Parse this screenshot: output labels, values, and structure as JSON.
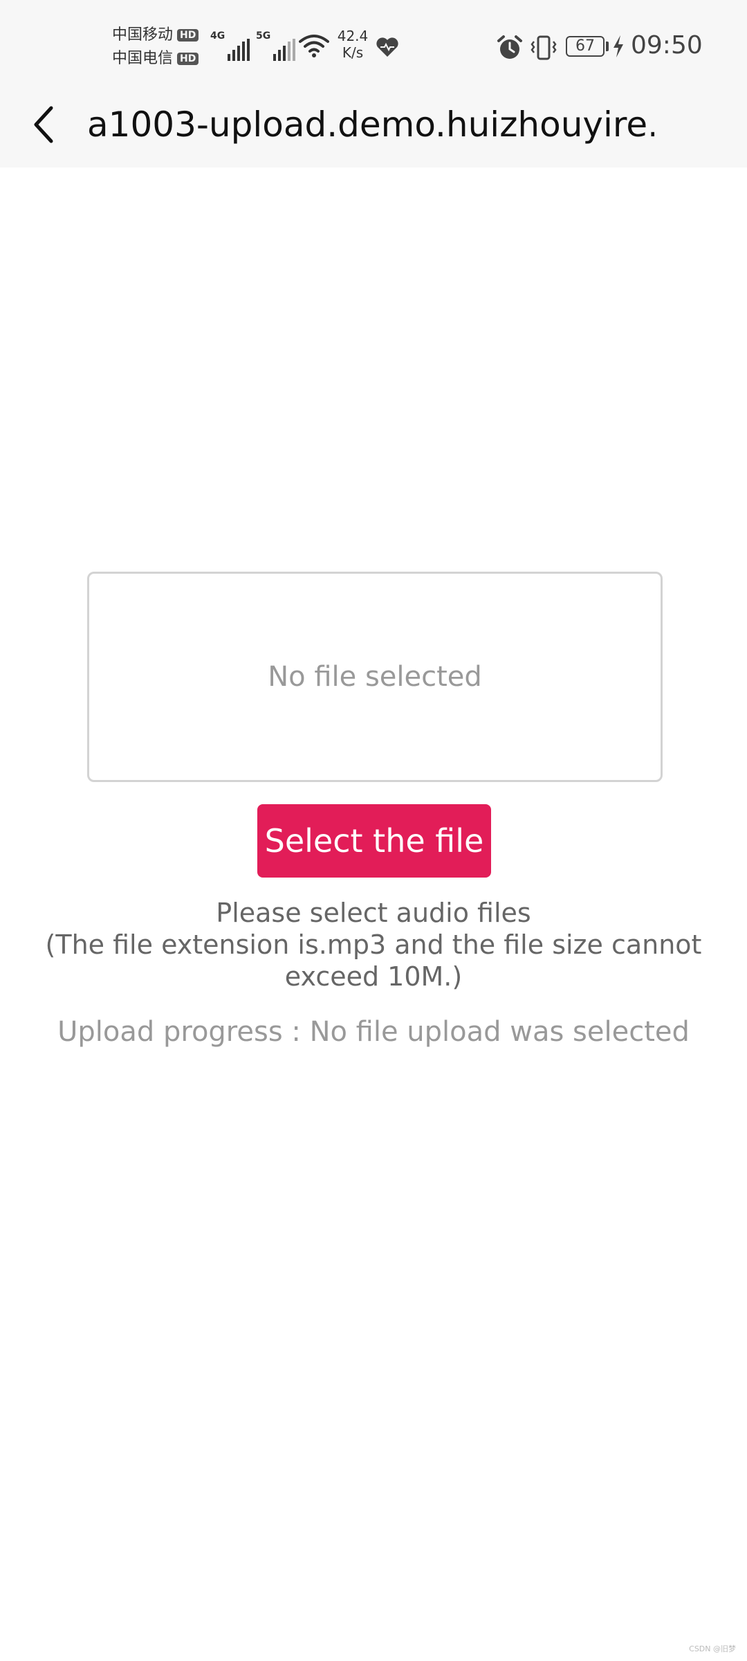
{
  "status_bar": {
    "carrier_1": "中国移动",
    "carrier_2": "中国电信",
    "hd_label": "HD",
    "network_1": "4G",
    "network_2": "5G",
    "speed_value": "42.4",
    "speed_unit": "K/s",
    "battery_level": "67",
    "time": "09:50",
    "icons": [
      "signal-icon",
      "wifi-icon",
      "heart-icon",
      "alarm-icon",
      "vibrate-icon",
      "battery-icon",
      "charging-icon"
    ]
  },
  "header": {
    "back_icon": "chevron-left-icon",
    "title": "a1003-upload.demo.huizhouyire..."
  },
  "main": {
    "file_status": "No file selected",
    "select_button_label": "Select the file",
    "hint_line_1": "Please select audio files",
    "hint_line_2": "(The file extension is.mp3 and the file size cannot exceed 10M.)",
    "progress_text": "Upload progress : No file upload was selected"
  },
  "watermark": "CSDN @旧梦",
  "colors": {
    "accent": "#e21d58",
    "bar_background": "#f7f7f7",
    "muted_text": "#999999"
  }
}
